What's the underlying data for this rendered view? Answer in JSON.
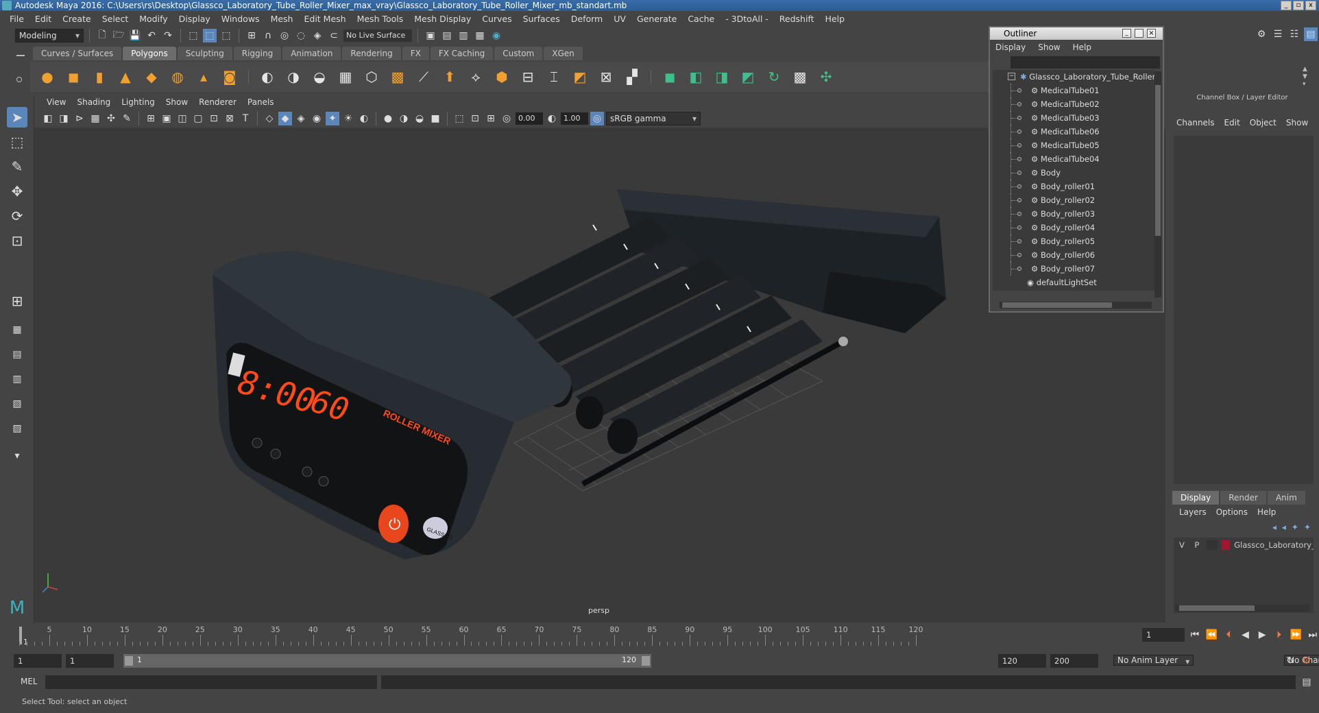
{
  "window": {
    "title": "Autodesk Maya 2016: C:\\Users\\rs\\Desktop\\Glassco_Laboratory_Tube_Roller_Mixer_max_vray\\Glassco_Laboratory_Tube_Roller_Mixer_mb_standart.mb",
    "min": "_",
    "max": "▫",
    "close": "x"
  },
  "menubar": [
    "File",
    "Edit",
    "Create",
    "Select",
    "Modify",
    "Display",
    "Windows",
    "Mesh",
    "Edit Mesh",
    "Mesh Tools",
    "Mesh Display",
    "Curves",
    "Surfaces",
    "Deform",
    "UV",
    "Generate",
    "Cache",
    "- 3DtoAll -",
    "Redshift",
    "Help"
  ],
  "toolbar": {
    "mode": "Modeling",
    "live_surface": "No Live Surface"
  },
  "shelf_tabs": [
    {
      "label": "Curves / Surfaces",
      "active": false
    },
    {
      "label": "Polygons",
      "active": true
    },
    {
      "label": "Sculpting",
      "active": false
    },
    {
      "label": "Rigging",
      "active": false
    },
    {
      "label": "Animation",
      "active": false
    },
    {
      "label": "Rendering",
      "active": false
    },
    {
      "label": "FX",
      "active": false
    },
    {
      "label": "FX Caching",
      "active": false
    },
    {
      "label": "Custom",
      "active": false
    },
    {
      "label": "XGen",
      "active": false
    }
  ],
  "panel_menu": [
    "View",
    "Shading",
    "Lighting",
    "Show",
    "Renderer",
    "Panels"
  ],
  "panel_toolbar": {
    "exposure": "0.00",
    "gamma": "1.00",
    "colorspace": "sRGB gamma"
  },
  "viewport": {
    "camera": "persp",
    "display_time": "8:00",
    "display_rpm": "60",
    "label": "ROLLER MIXER",
    "brand": "GLASSCO"
  },
  "outliner": {
    "title": "Outliner",
    "menu": [
      "Display",
      "Show",
      "Help"
    ],
    "root": "Glassco_Laboratory_Tube_Roller_",
    "items": [
      "MedicalTube01",
      "MedicalTube02",
      "MedicalTube03",
      "MedicalTube06",
      "MedicalTube05",
      "MedicalTube04",
      "Body",
      "Body_roller01",
      "Body_roller02",
      "Body_roller03",
      "Body_roller04",
      "Body_roller05",
      "Body_roller06",
      "Body_roller07"
    ],
    "lightset": "defaultLightSet"
  },
  "channelbox": {
    "title": "Channel Box / Layer Editor",
    "menu": [
      "Channels",
      "Edit",
      "Object",
      "Show"
    ],
    "layer_tabs": [
      "Display",
      "Render",
      "Anim"
    ],
    "layer_menu": [
      "Layers",
      "Options",
      "Help"
    ],
    "layer": {
      "v": "V",
      "p": "P",
      "name": "Glassco_Laboratory_Tu",
      "color": "#a01830"
    }
  },
  "timeline": {
    "ticks": [
      "5",
      "10",
      "15",
      "20",
      "25",
      "30",
      "35",
      "40",
      "45",
      "50",
      "55",
      "60",
      "65",
      "70",
      "75",
      "80",
      "85",
      "90",
      "95",
      "100",
      "105",
      "110",
      "115",
      "120"
    ],
    "start_label": "1",
    "current_frame": "1"
  },
  "range": {
    "start": "1",
    "playback_start": "1",
    "slider_start": "1",
    "slider_end": "120",
    "end": "120",
    "anim_end": "200",
    "anim_layer": "No Anim Layer",
    "char_set": "No Character Set"
  },
  "cmdline": {
    "lang": "MEL"
  },
  "helpline": {
    "text": "Select Tool: select an object"
  },
  "colors": {
    "accent": "#5a86b9",
    "shelf_orange": "#f0a030",
    "shelf_green": "#3fc08a",
    "display_red": "#ff4a1a"
  }
}
